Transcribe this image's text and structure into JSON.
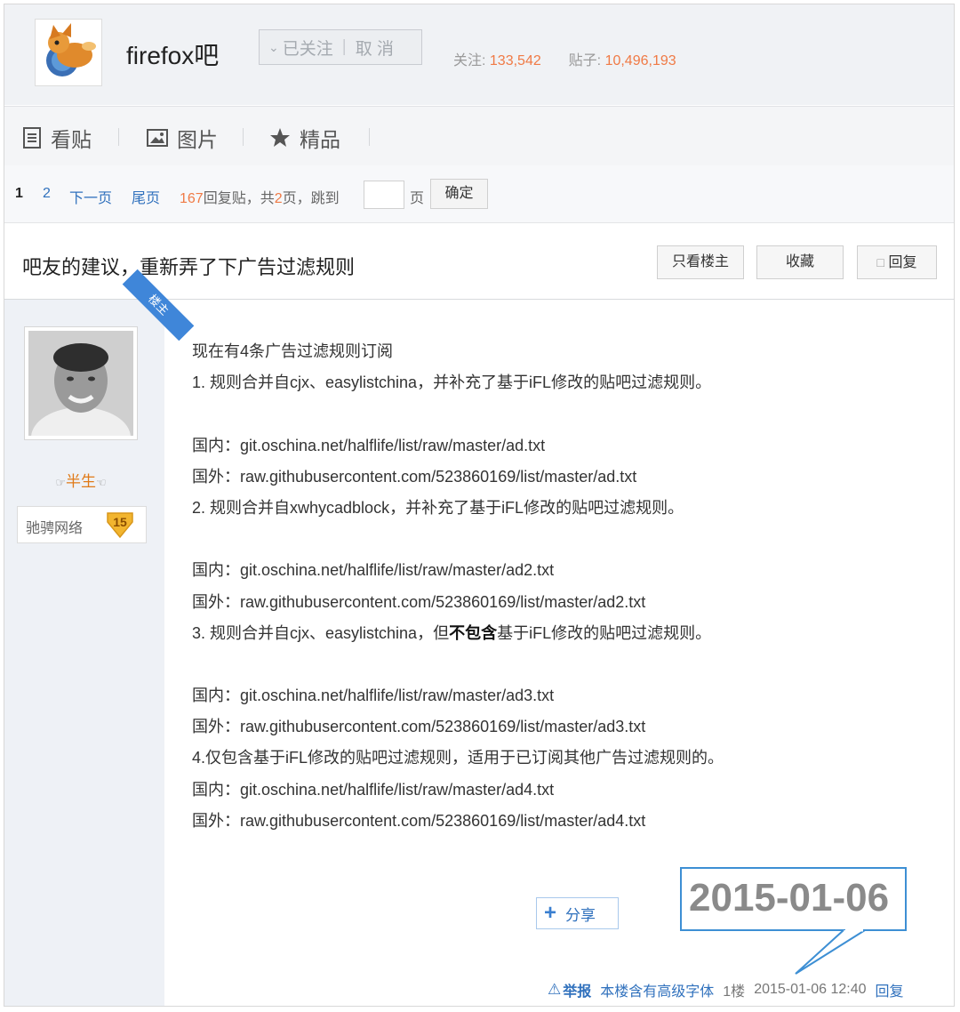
{
  "forum": {
    "name": "firefox吧",
    "follow": {
      "status_label": "已关注",
      "cancel_label": "取 消"
    },
    "stats": {
      "follow_label": "关注:",
      "follow_count": "133,542",
      "posts_label": "贴子:",
      "posts_count": "10,496,193"
    }
  },
  "tabs": [
    {
      "label": "看贴",
      "icon": "document-icon"
    },
    {
      "label": "图片",
      "icon": "picture-icon"
    },
    {
      "label": "精品",
      "icon": "star-icon"
    }
  ],
  "pager": {
    "current": "1",
    "page2": "2",
    "next": "下一页",
    "last": "尾页",
    "reply_count": "167",
    "reply_text": "回复贴，共",
    "total_pages": "2",
    "page_text": "页，跳到",
    "page_unit": "页",
    "confirm": "确定"
  },
  "thread": {
    "title": "吧友的建议，重新弄了下广告过滤规则",
    "buttons": {
      "only_op": "只看楼主",
      "favorite": "收藏",
      "reply": "回复"
    }
  },
  "post": {
    "badge": "楼主",
    "author": "半生",
    "level_name": "驰骋网络",
    "level": "15",
    "lines": [
      "现在有4条广告过滤规则订阅",
      "1. 规则合并自cjx、easylistchina，并补充了基于iFL修改的贴吧过滤规则。",
      "",
      "国内：git.oschina.net/halflife/list/raw/master/ad.txt",
      "国外：raw.githubusercontent.com/523860169/list/master/ad.txt",
      "2. 规则合并自xwhycadblock，并补充了基于iFL修改的贴吧过滤规则。",
      "",
      "国内：git.oschina.net/halflife/list/raw/master/ad2.txt",
      "国外：raw.githubusercontent.com/523860169/list/master/ad2.txt",
      "",
      "",
      "国内：git.oschina.net/halflife/list/raw/master/ad3.txt",
      "国外：raw.githubusercontent.com/523860169/list/master/ad3.txt",
      "4.仅包含基于iFL修改的贴吧过滤规则，适用于已订阅其他广告过滤规则的。",
      "国内：git.oschina.net/halflife/list/raw/master/ad4.txt",
      "国外：raw.githubusercontent.com/523860169/list/master/ad4.txt"
    ],
    "line3": {
      "prefix": "3. 规则合并自cjx、easylistchina，但",
      "bold": "不包含",
      "suffix": "基于iFL修改的贴吧过滤规则。"
    },
    "share": "分享",
    "callout_date": "2015-01-06",
    "footer": {
      "report": "举报",
      "font_note": "本楼含有高级字体",
      "floor": "1楼",
      "time": "2015-01-06 12:40",
      "reply": "回复"
    }
  }
}
